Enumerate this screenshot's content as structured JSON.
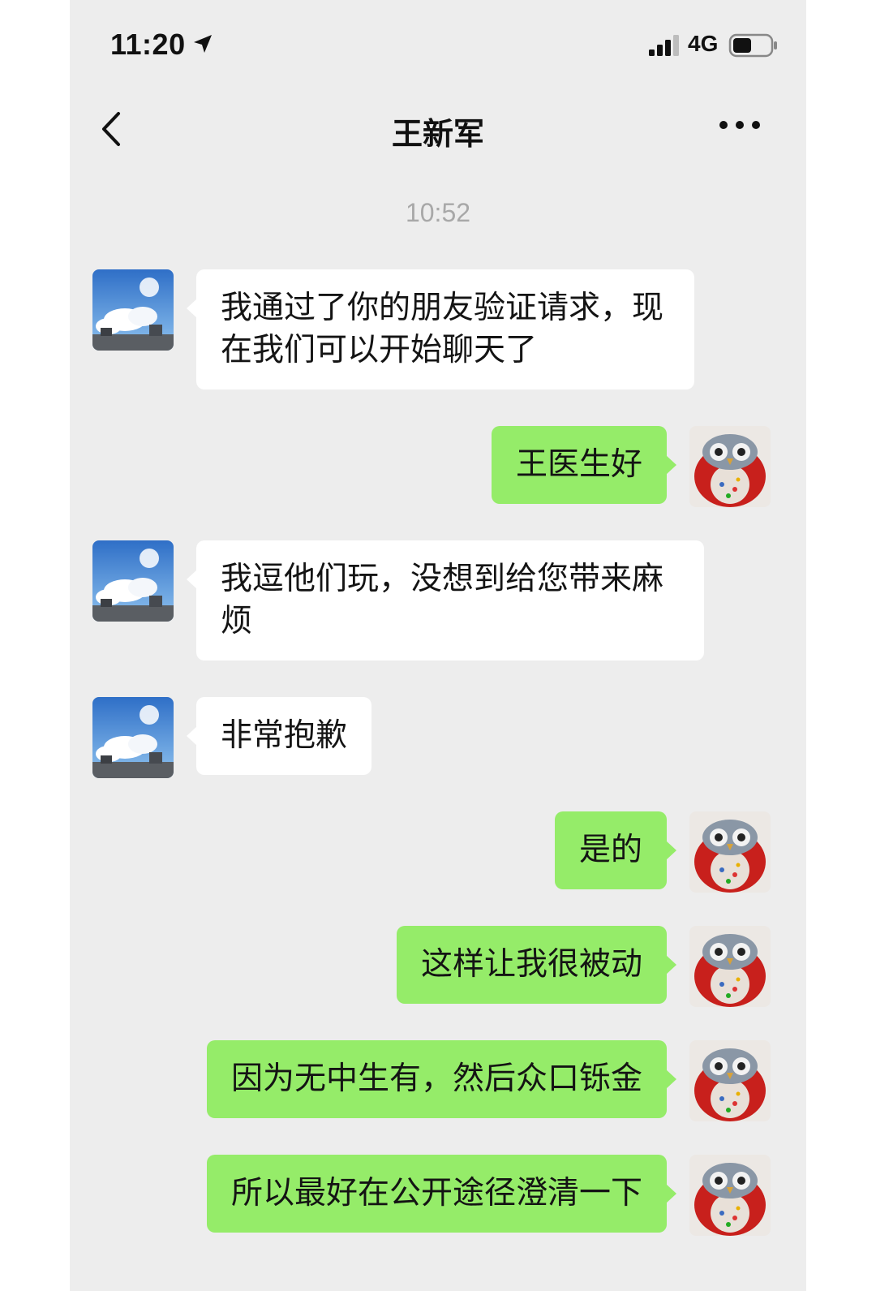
{
  "status_bar": {
    "time": "11:20",
    "network": "4G"
  },
  "nav": {
    "title": "王新军"
  },
  "timestamp": "10:52",
  "messages": [
    {
      "side": "in",
      "text": "我通过了你的朋友验证请求，现在我们可以开始聊天了"
    },
    {
      "side": "out",
      "text": "王医生好"
    },
    {
      "side": "in",
      "text": "我逗他们玩，没想到给您带来麻烦"
    },
    {
      "side": "in",
      "text": "非常抱歉"
    },
    {
      "side": "out",
      "text": "是的"
    },
    {
      "side": "out",
      "text": "这样让我很被动"
    },
    {
      "side": "out",
      "text": "因为无中生有，然后众口铄金"
    },
    {
      "side": "out",
      "text": "所以最好在公开途径澄清一下"
    }
  ],
  "colors": {
    "background": "#ededed",
    "incoming_bubble": "#ffffff",
    "outgoing_bubble": "#95ec69"
  },
  "avatars": {
    "contact": "sky-clouds-photo",
    "self": "red-owl-figurine-photo"
  }
}
